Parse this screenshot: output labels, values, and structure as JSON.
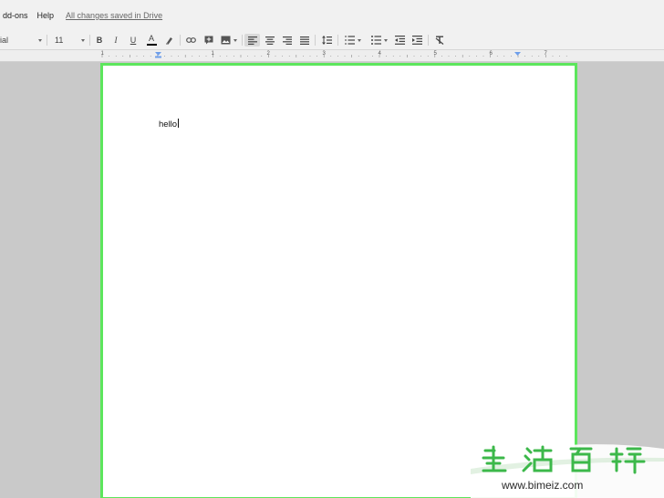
{
  "menu": {
    "items": [
      "dd-ons",
      "Help"
    ],
    "save_status": "All changes saved in Drive"
  },
  "toolbar": {
    "font_name": "ial",
    "font_size": "11",
    "bold": "B",
    "italic": "I",
    "underline": "U",
    "text_color": "A"
  },
  "ruler": {
    "numbers": [
      "1",
      "1",
      "2",
      "3",
      "4",
      "5",
      "6",
      "7"
    ]
  },
  "document": {
    "text": "hello"
  },
  "watermark": {
    "chars": "生活百科",
    "url": "www.bimeiz.com"
  },
  "colors": {
    "page_border": "#5ce65c",
    "background": "#c9c9c9",
    "watermark_green": "#3cb84a"
  }
}
